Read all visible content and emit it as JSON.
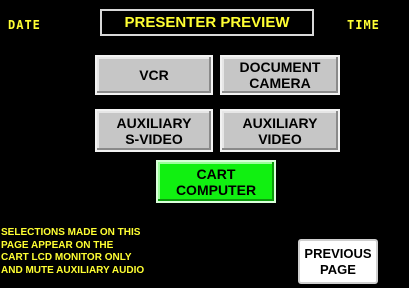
{
  "header": {
    "date_label": "DATE",
    "title": "PRESENTER PREVIEW",
    "time_label": "TIME"
  },
  "sources": {
    "vcr": {
      "line1": "VCR"
    },
    "document_camera": {
      "line1": "DOCUMENT",
      "line2": "CAMERA"
    },
    "aux_svideo": {
      "line1": "AUXILIARY",
      "line2": "S-VIDEO"
    },
    "aux_video": {
      "line1": "AUXILIARY",
      "line2": "VIDEO"
    },
    "cart_computer": {
      "line1": "CART",
      "line2": "COMPUTER",
      "state": "selected"
    }
  },
  "notice": {
    "lines": [
      "SELECTIONS MADE ON THIS",
      "PAGE APPEAR ON THE",
      "CART LCD MONITOR ONLY",
      "AND MUTE AUXILIARY AUDIO"
    ]
  },
  "previous_page": {
    "line1": "PREVIOUS",
    "line2": "PAGE"
  },
  "colors": {
    "background": "#000000",
    "text_yellow": "#ffff33",
    "button_gray": "#c6c6c6",
    "selected_green": "#11f011",
    "button_white": "#ffffff"
  }
}
